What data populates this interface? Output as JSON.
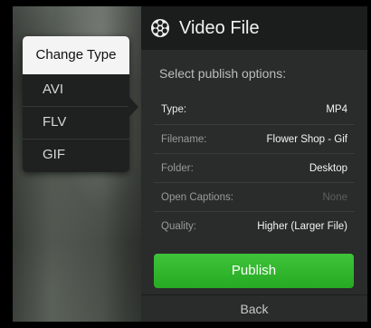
{
  "change_type_menu": {
    "title": "Change Type",
    "items": [
      "AVI",
      "FLV",
      "GIF"
    ]
  },
  "panel": {
    "title": "Video File",
    "icon": "film-reel-icon",
    "subtitle": "Select publish options:",
    "options": [
      {
        "label": "Type:",
        "value": "MP4",
        "enabled": true
      },
      {
        "label": "Filename:",
        "value": "Flower Shop - Gif",
        "enabled": true
      },
      {
        "label": "Folder:",
        "value": "Desktop",
        "enabled": true
      },
      {
        "label": "Open Captions:",
        "value": "None",
        "enabled": false
      },
      {
        "label": "Quality:",
        "value": "Higher (Larger File)",
        "enabled": true
      }
    ],
    "publish_label": "Publish",
    "back_label": "Back"
  },
  "colors": {
    "publish_green": "#2fb52b",
    "panel_bg": "#2a2b2b",
    "header_bg": "#1b1c1c"
  }
}
